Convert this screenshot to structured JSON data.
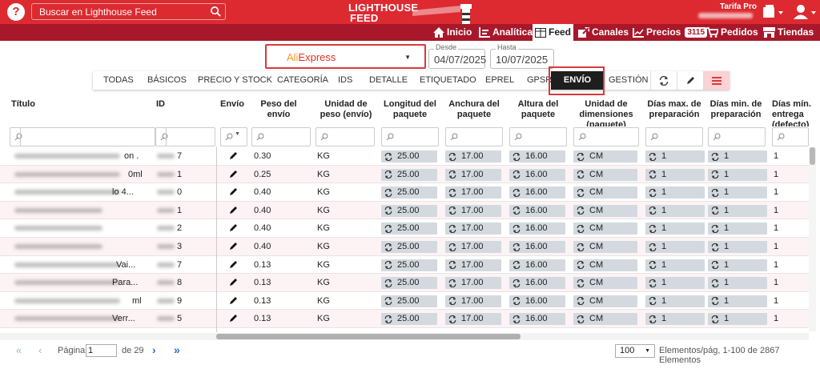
{
  "header": {
    "search_placeholder": "Buscar en Lighthouse Feed",
    "logo_line1": "LIGHTHOUSE",
    "logo_line2": "FEED",
    "plan": "Tarifa Pro",
    "help": "?"
  },
  "nav": {
    "items": [
      "Inicio",
      "Analítica",
      "Feed",
      "Canales",
      "Precios",
      "Pedidos",
      "Tiendas"
    ],
    "precios_badge": "3115",
    "active": "Feed"
  },
  "marketplace": {
    "name_ali": "Ali",
    "name_express": "Express"
  },
  "dates": {
    "from_label": "Desde",
    "from": "04/07/2025",
    "to_label": "Hasta",
    "to": "10/07/2025"
  },
  "tabs": {
    "items": [
      "TODAS",
      "BÁSICOS",
      "PRECIO Y STOCK",
      "CATEGORÍA",
      "IDS",
      "DETALLE",
      "ETIQUETADO",
      "EPREL",
      "GPSR",
      "ENVÍO",
      "GESTIÓN"
    ],
    "active": "ENVÍO"
  },
  "columns": [
    "Título",
    "ID",
    "Envío",
    "Peso del envío",
    "Unidad de peso (envío)",
    "Longitud del paquete",
    "Anchura del paquete",
    "Altura del paquete",
    "Unidad de dimensiones (paquete)",
    "Días max. de preparación",
    "Días min. de preparación",
    "Días mín. entrega (defecto)"
  ],
  "rows": [
    {
      "title_suffix": "on .",
      "id_suffix": "7",
      "peso": "0.30",
      "unidad": "KG",
      "long": "25.00",
      "anch": "17.00",
      "alt": "16.00",
      "dim": "CM",
      "dmax": "1",
      "dmin": "1",
      "dent": "1"
    },
    {
      "title_suffix": "0ml",
      "id_suffix": "1",
      "peso": "0.25",
      "unidad": "KG",
      "long": "25.00",
      "anch": "17.00",
      "alt": "16.00",
      "dim": "CM",
      "dmax": "1",
      "dmin": "1",
      "dent": "1"
    },
    {
      "title_suffix": "lo 4...",
      "id_suffix": "0",
      "peso": "0.40",
      "unidad": "KG",
      "long": "25.00",
      "anch": "17.00",
      "alt": "16.00",
      "dim": "CM",
      "dmax": "1",
      "dmin": "1",
      "dent": "1"
    },
    {
      "title_suffix": "",
      "id_suffix": "1",
      "peso": "0.40",
      "unidad": "KG",
      "long": "25.00",
      "anch": "17.00",
      "alt": "16.00",
      "dim": "CM",
      "dmax": "1",
      "dmin": "1",
      "dent": "1"
    },
    {
      "title_suffix": "",
      "id_suffix": "2",
      "peso": "0.40",
      "unidad": "KG",
      "long": "25.00",
      "anch": "17.00",
      "alt": "16.00",
      "dim": "CM",
      "dmax": "1",
      "dmin": "1",
      "dent": "1"
    },
    {
      "title_suffix": "",
      "id_suffix": "3",
      "peso": "0.40",
      "unidad": "KG",
      "long": "25.00",
      "anch": "17.00",
      "alt": "16.00",
      "dim": "CM",
      "dmax": "1",
      "dmin": "1",
      "dent": "1"
    },
    {
      "title_suffix": "Vai...",
      "id_suffix": "7",
      "peso": "0.13",
      "unidad": "KG",
      "long": "25.00",
      "anch": "17.00",
      "alt": "16.00",
      "dim": "CM",
      "dmax": "1",
      "dmin": "1",
      "dent": "1"
    },
    {
      "title_suffix": "Para...",
      "id_suffix": "8",
      "peso": "0.13",
      "unidad": "KG",
      "long": "25.00",
      "anch": "17.00",
      "alt": "16.00",
      "dim": "CM",
      "dmax": "1",
      "dmin": "1",
      "dent": "1"
    },
    {
      "title_suffix": "ml",
      "id_suffix": "9",
      "peso": "0.13",
      "unidad": "KG",
      "long": "25.00",
      "anch": "17.00",
      "alt": "16.00",
      "dim": "CM",
      "dmax": "1",
      "dmin": "1",
      "dent": "1"
    },
    {
      "title_suffix": "Verr...",
      "id_suffix": "5",
      "peso": "0.13",
      "unidad": "KG",
      "long": "25.00",
      "anch": "17.00",
      "alt": "16.00",
      "dim": "CM",
      "dmax": "1",
      "dmin": "1",
      "dent": "1"
    }
  ],
  "footer": {
    "page_label": "Página",
    "page": "1",
    "of": "de 29",
    "per_page": "100",
    "summary": "Elementos/pág, 1-100 de 2867 Elementos"
  },
  "colors": {
    "brand_red": "#dc2a30",
    "nav_red": "#a8182a",
    "outline_red": "#d93a3a",
    "pill_gray": "#d3d9df"
  }
}
